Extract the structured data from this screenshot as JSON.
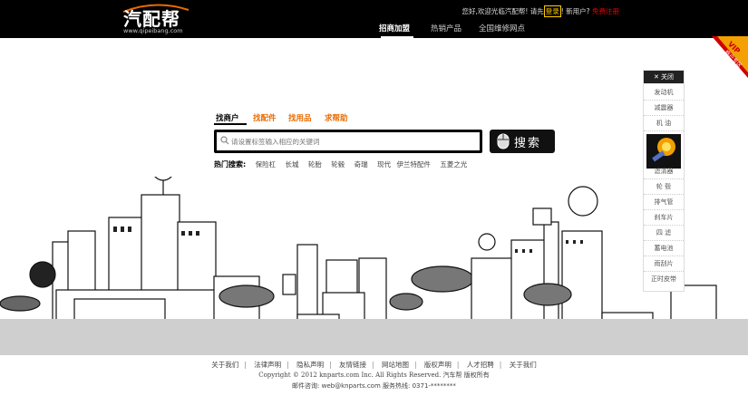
{
  "header": {
    "logo_text": "汽配帮",
    "logo_url": "www.qipeibang.com",
    "welcome_prefix": "您好,欢迎光临汽配帮! 请先",
    "login": "登录",
    "new_user": "! 新用户?",
    "register": "免费注册"
  },
  "nav": [
    {
      "label": "招商加盟",
      "active": true
    },
    {
      "label": "热销产品",
      "active": false
    },
    {
      "label": "全国维修网点",
      "active": false
    }
  ],
  "vip": {
    "badge": "VIP",
    "text": "商户专区"
  },
  "search": {
    "tabs": [
      {
        "label": "找商户",
        "active": true
      },
      {
        "label": "找配件",
        "active": false
      },
      {
        "label": "找用品",
        "active": false
      },
      {
        "label": "求帮助",
        "active": false
      }
    ],
    "placeholder": "请设置标签输入相应的关键词",
    "button_label": "搜索",
    "hot_label": "热门搜索:",
    "hot_keywords": [
      "保险杠",
      "长城",
      "轮胎",
      "轮毂",
      "奇瑞",
      "现代",
      "伊兰特配件",
      "五菱之光"
    ]
  },
  "sidebar": {
    "close_label": "关闭",
    "items": [
      "发动机",
      "减震器",
      "机 油",
      "滤清器",
      "轮 毂",
      "排气管",
      "刹车片",
      "四 滤",
      "蓄电池",
      "雨刮片",
      "正时皮带"
    ]
  },
  "footer": {
    "links": [
      "关于我们",
      "法律声明",
      "隐私声明",
      "友情链接",
      "网站地图",
      "版权声明",
      "人才招聘",
      "关于我们"
    ],
    "copyright": "Copyright © 2012 knparts.com Inc. All Rights Reserved. 汽车帮 版权所有",
    "contact": "邮件咨询: web@knparts.com  服务热线: 0371-********"
  },
  "colors": {
    "header_bg": "#000000",
    "accent_orange": "#e86b00",
    "login_yellow": "#ffcc00",
    "register_red": "#ee0000",
    "ground_gray": "#cfcfcf"
  }
}
